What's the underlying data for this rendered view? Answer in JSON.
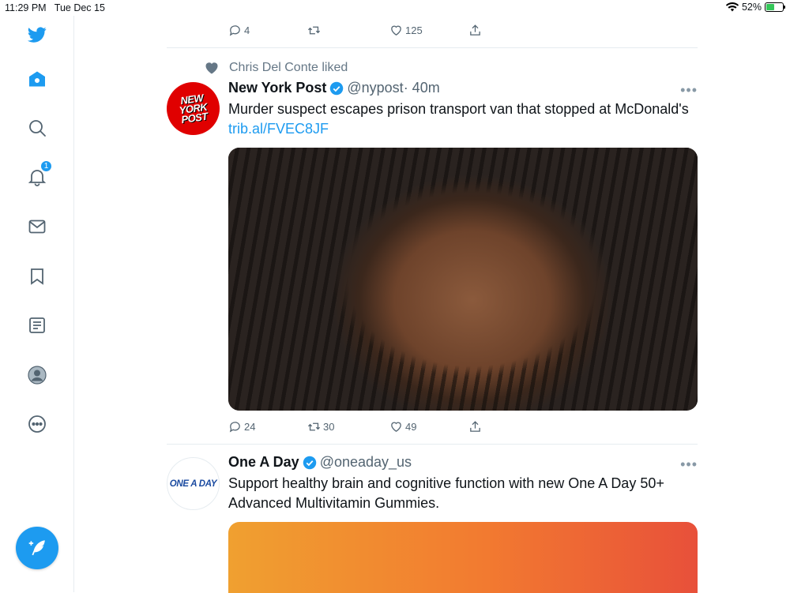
{
  "status_bar": {
    "time": "11:29 PM",
    "date": "Tue Dec 15",
    "battery": "52%",
    "battery_level": 0.52
  },
  "sidebar": {
    "items": [
      {
        "name": "twitter-logo",
        "icon": "twitter-bird-icon"
      },
      {
        "name": "home",
        "icon": "home-icon"
      },
      {
        "name": "explore",
        "icon": "search-icon"
      },
      {
        "name": "notifications",
        "icon": "bell-icon",
        "badge": "1"
      },
      {
        "name": "messages",
        "icon": "mail-icon"
      },
      {
        "name": "bookmarks",
        "icon": "bookmark-icon"
      },
      {
        "name": "lists",
        "icon": "list-icon"
      },
      {
        "name": "profile",
        "icon": "profile-icon"
      },
      {
        "name": "more",
        "icon": "more-circle-icon"
      }
    ],
    "compose_icon": "compose-tweet-icon"
  },
  "colors": {
    "accent": "#1d9bf0",
    "nyp_red": "#e00000"
  },
  "prev_tweet": {
    "replies": "4",
    "retweets": "",
    "likes": "125"
  },
  "tweets": [
    {
      "social_context": "Chris Del Conte liked",
      "avatar_text": "NEW YORK POST",
      "name": "New York Post",
      "handle": "@nypost",
      "time": "· 40m",
      "text": "Murder suspect escapes prison transport van that stopped at McDonald's",
      "link": "trib.al/FVEC8JF",
      "replies": "24",
      "retweets": "30",
      "likes": "49"
    },
    {
      "avatar_text": "ONE A DAY",
      "name": "One A Day",
      "handle": "@oneaday_us",
      "text": "Support healthy brain and cognitive function with new One A Day 50+ Advanced Multivitamin Gummies."
    }
  ]
}
